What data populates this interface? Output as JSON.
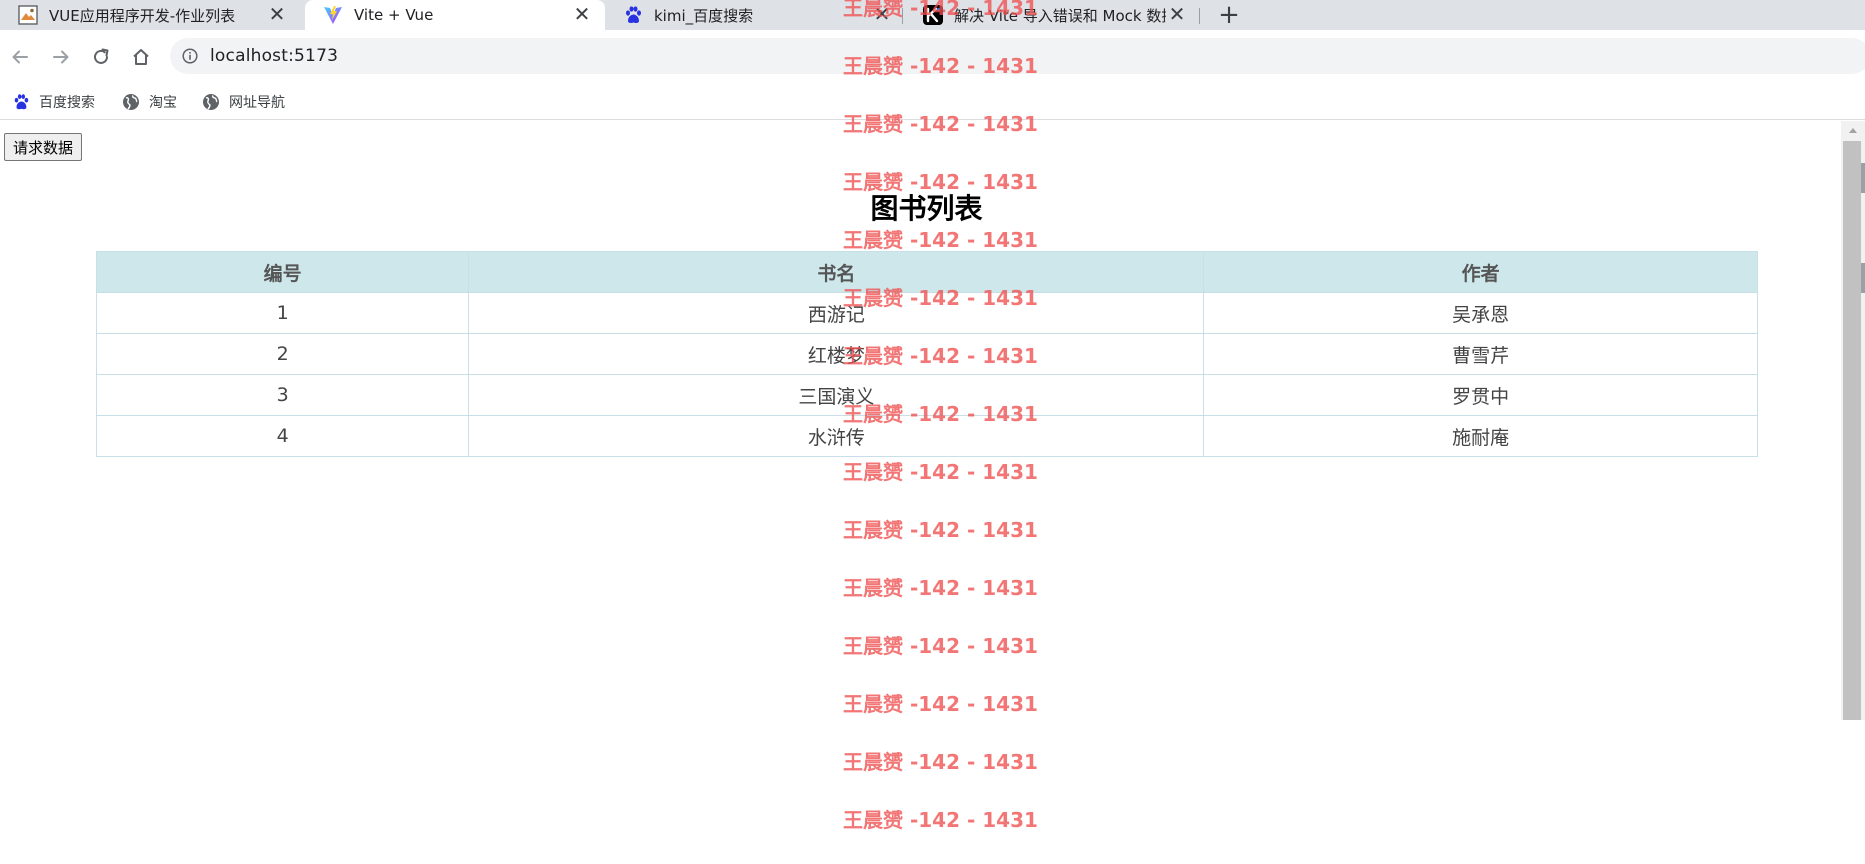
{
  "browser": {
    "tabs": [
      {
        "title": "VUE应用程序开发-作业列表",
        "icon": "image-favicon-icon",
        "active": false
      },
      {
        "title": "Vite + Vue",
        "icon": "vite-logo-icon",
        "active": true
      },
      {
        "title": "kimi_百度搜索",
        "icon": "baidu-paw-icon",
        "active": false
      },
      {
        "title": "解决 Vite 导入错误和 Mock 数据",
        "icon": "kimi-k-icon",
        "active": false
      }
    ],
    "close_glyph": "✕",
    "new_tab_glyph": "+",
    "address_bar": {
      "url": "localhost:5173"
    },
    "bookmarks": [
      {
        "label": "百度搜索",
        "icon": "baidu-paw-icon"
      },
      {
        "label": "淘宝",
        "icon": "globe-icon"
      },
      {
        "label": "网址导航",
        "icon": "globe-icon"
      }
    ]
  },
  "page": {
    "request_button_label": "请求数据",
    "title": "图书列表",
    "table": {
      "headers": [
        "编号",
        "书名",
        "作者"
      ],
      "rows": [
        [
          "1",
          "西游记",
          "吴承恩"
        ],
        [
          "2",
          "红楼梦",
          "曹雪芹"
        ],
        [
          "3",
          "三国演义",
          "罗贯中"
        ],
        [
          "4",
          "水浒传",
          "施耐庵"
        ]
      ]
    }
  },
  "watermark": {
    "text": "王晨赟 -142 - 1431",
    "color": "#f05050"
  },
  "colors": {
    "tab_strip_bg": "#dee1e6",
    "table_header_bg": "#cde7ea",
    "table_border": "#c9dfe8",
    "watermark": "#f05050"
  }
}
